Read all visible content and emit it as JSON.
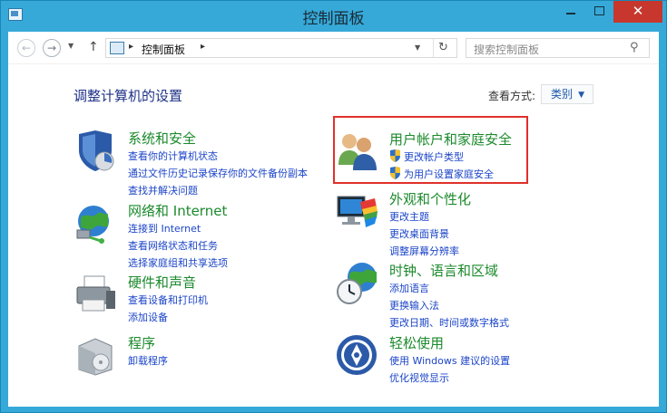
{
  "window": {
    "title": "控制面板"
  },
  "addressbar": {
    "path_root": "控制面板",
    "search_placeholder": "搜索控制面板"
  },
  "main": {
    "heading": "调整计算机的设置",
    "view_by_label": "查看方式:",
    "view_by_value": "类别"
  },
  "categories": {
    "system": {
      "title": "系统和安全",
      "links": [
        "查看你的计算机状态",
        "通过文件历史记录保存你的文件备份副本",
        "查找并解决问题"
      ]
    },
    "network": {
      "title": "网络和 Internet",
      "links": [
        "连接到 Internet",
        "查看网络状态和任务",
        "选择家庭组和共享选项"
      ]
    },
    "hardware": {
      "title": "硬件和声音",
      "links": [
        "查看设备和打印机",
        "添加设备"
      ]
    },
    "programs": {
      "title": "程序",
      "links": [
        "卸载程序"
      ]
    },
    "users": {
      "title": "用户帐户和家庭安全",
      "links": [
        "更改帐户类型",
        "为用户设置家庭安全"
      ]
    },
    "appearance": {
      "title": "外观和个性化",
      "links": [
        "更改主题",
        "更改桌面背景",
        "调整屏幕分辨率"
      ]
    },
    "clock": {
      "title": "时钟、语言和区域",
      "links": [
        "添加语言",
        "更换输入法",
        "更改日期、时间或数字格式"
      ]
    },
    "ease": {
      "title": "轻松使用",
      "links": [
        "使用 Windows 建议的设置",
        "优化视觉显示"
      ]
    }
  }
}
